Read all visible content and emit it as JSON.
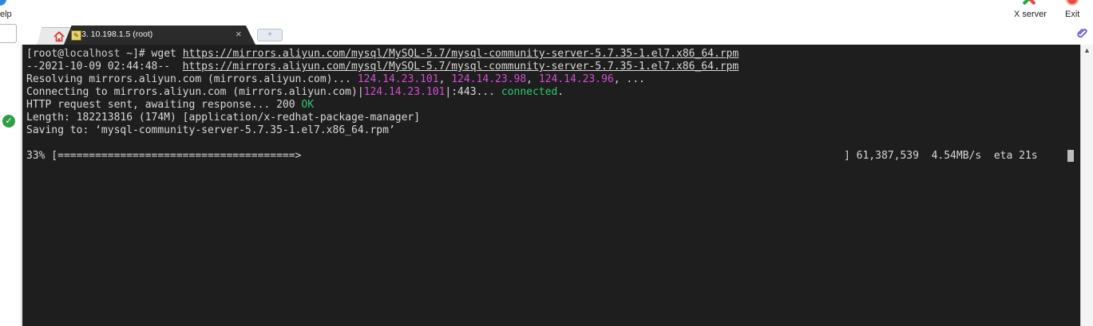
{
  "toolbar": {
    "help_label": "elp",
    "xserver_label": "X server",
    "exit_label": "Exit"
  },
  "tabs": {
    "session_label": "3. 10.198.1.5 (root)",
    "close_glyph": "×",
    "new_tab_glyph": "+"
  },
  "terminal": {
    "line1": {
      "p1": "[root@",
      "host": "localhost",
      "p2": " ~]# wget ",
      "url": "https://mirrors.aliyun.com/mysql/MySQL-5.7/mysql-community-server-5.7.35-1.el7.x86_64.rpm"
    },
    "line2": {
      "p1": "--2021-10-09 02:44:48--  ",
      "url": "https://mirrors.aliyun.com/mysql/MySQL-5.7/mysql-community-server-5.7.35-1.el7.x86_64.rpm"
    },
    "line3": {
      "p1": "Resolving mirrors.aliyun.com (mirrors.aliyun.com)... ",
      "ip1": "124.14.23.101",
      "sep1": ", ",
      "ip2": "124.14.23.98",
      "sep2": ", ",
      "ip3": "124.14.23.96",
      "tail": ", ..."
    },
    "line4": {
      "p1": "Connecting to mirrors.aliyun.com (mirrors.aliyun.com)|",
      "ip": "124.14.23.101",
      "p2": "|:443... ",
      "status": "connected",
      "tail": "."
    },
    "line5": {
      "p1": "HTTP request sent, awaiting response... 200 ",
      "status": "OK"
    },
    "line6": "Length: 182213816 (174M) [application/x-redhat-package-manager]",
    "line7": "Saving to: ‘mysql-community-server-5.7.35-1.el7.x86_64.rpm’",
    "progress": {
      "bar": "33% [======================================>",
      "stats": "] 61,387,539  4.54MB/s  eta 21s"
    }
  },
  "colors": {
    "terminal_bg": "#1e1e1e",
    "ip_magenta": "#d34ed3",
    "status_green": "#2dc96a"
  },
  "icons": [
    "help-icon",
    "x-server-icon",
    "exit-icon",
    "home-icon",
    "terminal-session-icon",
    "close-icon",
    "paperclip-icon",
    "check-icon",
    "scroll-up-icon"
  ]
}
